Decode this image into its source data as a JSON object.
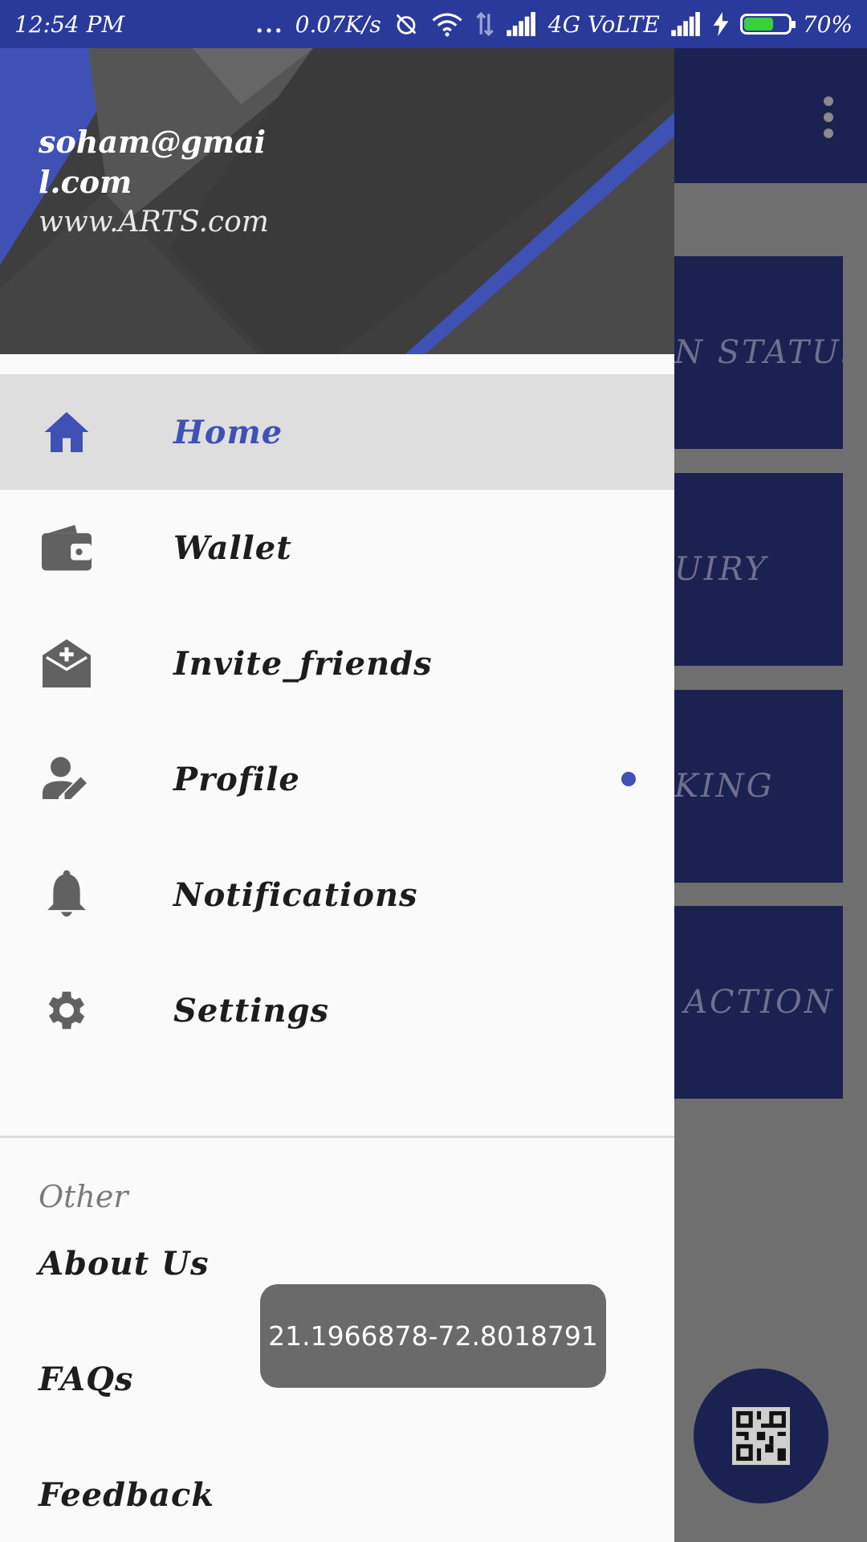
{
  "status_bar": {
    "time": "12:54 PM",
    "dots": "...",
    "speed": "0.07K/s",
    "network": "4G VoLTE",
    "battery_percent": "70%",
    "battery_level": 0.7
  },
  "background_app": {
    "tiles": [
      {
        "label": "N STATUS"
      },
      {
        "label": "UIRY"
      },
      {
        "label": "KING"
      },
      {
        "label": "ACTION"
      }
    ],
    "fab_icon": "qr-code-icon",
    "menu_icon": "more-vert-icon"
  },
  "drawer": {
    "header": {
      "email": "soham@gmail.com",
      "website": "www.ARTS.com"
    },
    "items": [
      {
        "label": "Home",
        "icon": "home-icon",
        "active": true
      },
      {
        "label": "Wallet",
        "icon": "wallet-icon"
      },
      {
        "label": "Invite_friends",
        "icon": "invite-icon"
      },
      {
        "label": "Profile",
        "icon": "profile-edit-icon",
        "badge": true
      },
      {
        "label": "Notifications",
        "icon": "bell-icon"
      },
      {
        "label": "Settings",
        "icon": "gear-icon"
      }
    ],
    "other_section": {
      "title": "Other",
      "items": [
        {
          "label": "About Us"
        },
        {
          "label": "FAQs"
        },
        {
          "label": "Feedback"
        }
      ]
    }
  },
  "toast": {
    "text": "21.1966878-72.8018791"
  },
  "colors": {
    "status_bar": "#2a3a9a",
    "accent": "#3f51b5",
    "app_bar": "#1b2150",
    "drawer_bg": "#fafafa",
    "active_bg": "#dedede"
  }
}
